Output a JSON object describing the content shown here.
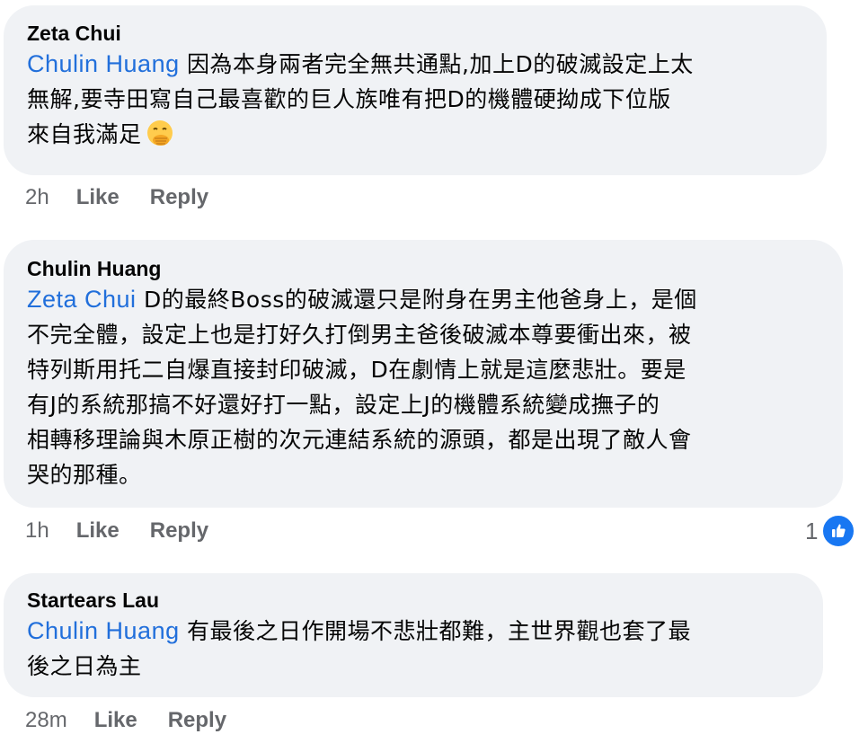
{
  "comments": [
    {
      "author": "Zeta Chui",
      "mention": "Chulin Huang",
      "lines": [
        " 因為本身兩者完全無共通點,加上D的破滅設定上太",
        "無解,要寺田寫自己最喜歡的巨人族唯有把D的機體硬拗成下位版",
        "來自我滿足"
      ],
      "emoji": "face-with-hand-over-mouth-icon",
      "time": "2h",
      "like_label": "Like",
      "reply_label": "Reply"
    },
    {
      "author": "Chulin Huang",
      "mention": "Zeta Chui",
      "lines": [
        " D的最終Boss的破滅還只是附身在男主他爸身上，是個",
        "不完全體，設定上也是打好久打倒男主爸後破滅本尊要衝出來，被",
        "特列斯用托二自爆直接封印破滅，D在劇情上就是這麼悲壯。要是",
        "有J的系統那搞不好還好打一點，設定上J的機體系統變成撫子的",
        "相轉移理論與木原正樹的次元連結系統的源頭，都是出現了敵人會",
        "哭的那種。"
      ],
      "time": "1h",
      "like_label": "Like",
      "reply_label": "Reply",
      "reaction_count": "1",
      "reaction_icon": "like-thumb-icon"
    },
    {
      "author": "Startears Lau",
      "mention": "Chulin Huang",
      "lines": [
        " 有最後之日作開場不悲壯都難，主世界觀也套了最",
        "後之日為主"
      ],
      "time": "28m",
      "like_label": "Like",
      "reply_label": "Reply"
    }
  ],
  "colors": {
    "bubble": "#f0f2f5",
    "mention": "#216fdb",
    "meta": "#65676b",
    "like_badge": "#1877f2"
  }
}
